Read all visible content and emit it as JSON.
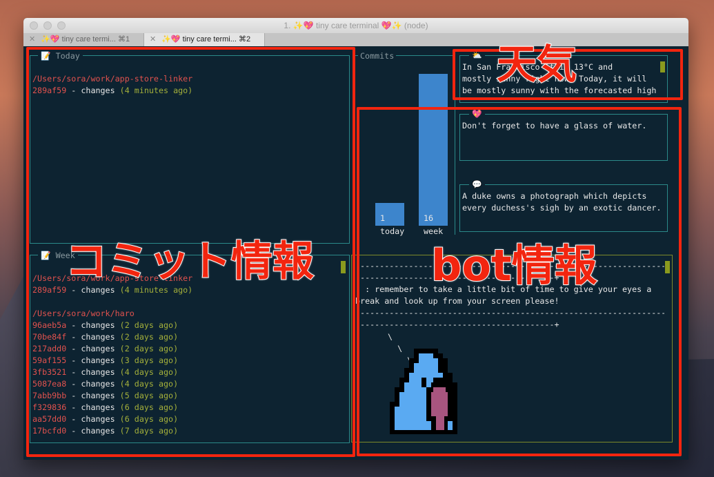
{
  "window": {
    "title": "1. ✨💖 tiny care terminal 💖✨ (node)",
    "tabs": [
      {
        "label": "✨💖 tiny care termi...",
        "shortcut": "⌘1"
      },
      {
        "label": "✨💖 tiny care termi...",
        "shortcut": "⌘2"
      }
    ]
  },
  "today": {
    "title": "📝 Today",
    "repos": [
      {
        "path": "/Users/sora/work/app-store-linker",
        "commits": [
          {
            "hash": "289af59",
            "msg": " - changes ",
            "ago": "(4 minutes ago)"
          }
        ]
      }
    ]
  },
  "week": {
    "title": "📝 Week",
    "repos": [
      {
        "path": "/Users/sora/work/app-store-linker",
        "commits": [
          {
            "hash": "289af59",
            "msg": " - changes ",
            "ago": "(4 minutes ago)"
          }
        ]
      },
      {
        "path": "/Users/sora/work/haro",
        "commits": [
          {
            "hash": "96aeb5a",
            "msg": " - changes ",
            "ago": "(2 days ago)"
          },
          {
            "hash": "70be84f",
            "msg": " - changes ",
            "ago": "(2 days ago)"
          },
          {
            "hash": "217add0",
            "msg": " - changes ",
            "ago": "(2 days ago)"
          },
          {
            "hash": "59af155",
            "msg": " - changes ",
            "ago": "(3 days ago)"
          },
          {
            "hash": "3fb3521",
            "msg": " - changes ",
            "ago": "(4 days ago)"
          },
          {
            "hash": "5087ea8",
            "msg": " - changes ",
            "ago": "(4 days ago)"
          },
          {
            "hash": "7abb9bb",
            "msg": " - changes ",
            "ago": "(5 days ago)"
          },
          {
            "hash": "f329836",
            "msg": " - changes ",
            "ago": "(6 days ago)"
          },
          {
            "hash": "aa57dd0",
            "msg": " - changes ",
            "ago": "(6 days ago)"
          },
          {
            "hash": "17bcfd0",
            "msg": " - changes ",
            "ago": "(7 days ago)"
          }
        ]
      }
    ]
  },
  "chart_data": {
    "type": "bar",
    "title": "Commits",
    "categories": [
      "today",
      "week"
    ],
    "values": [
      1,
      16
    ],
    "ylim": [
      0,
      16
    ]
  },
  "weather": {
    "icon": "⛅",
    "lines": [
      "In San Francisco it is 13°C and",
      "mostly sunny right now. Today, it will",
      "be mostly sunny with the forecasted high"
    ]
  },
  "care": {
    "icon": "💖",
    "lines": [
      "Don't forget to have a glass of water."
    ]
  },
  "quote": {
    "icon": "💬",
    "lines": [
      "A duke owns a photograph which depicts",
      "every duchess's sigh by an exotic dancer."
    ]
  },
  "bot": {
    "lines": [
      "---------------------------------------------------------------------------------",
      "-----------------------------------------+",
      "  : remember to take a little bit of time to give your eyes a",
      "break and look up from your screen please!",
      "---------------------------------------------------------------------------------",
      "-----------------------------------------+"
    ],
    "tail": [
      "\\",
      "  \\",
      "    \\"
    ]
  },
  "annotations": {
    "commits": "コミット情報",
    "weather": "天気",
    "bot": "bot情報"
  }
}
